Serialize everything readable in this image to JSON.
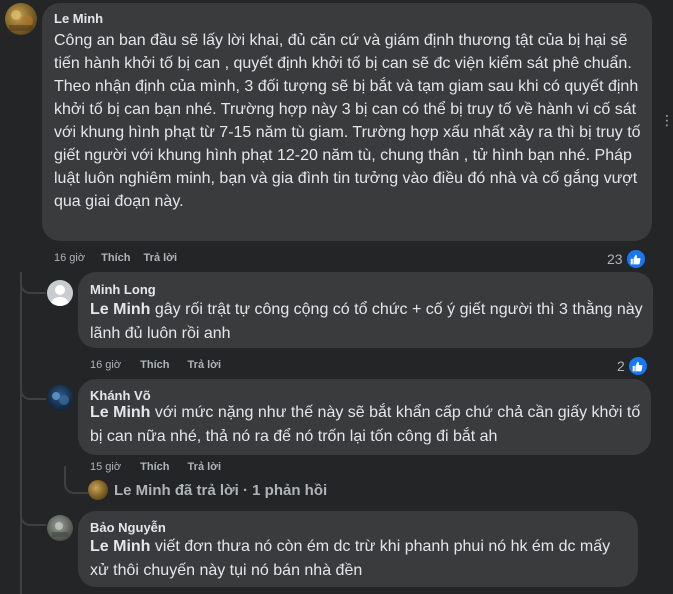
{
  "comments": [
    {
      "author": "Le Minh",
      "text": "Công an ban đầu sẽ lấy lời khai, đủ căn cứ và giám định thương tật của bị hại sẽ tiến hành khởi tố bị can , quyết định khởi tố bị can sẽ đc viện kiểm sát phê chuẩn. Theo nhận định của mình, 3 đối tượng sẽ bị bắt và tạm giam sau khi có quyết định khởi tố bị can bạn nhé. Trường hợp này 3 bị can có thể bị truy tố về hành vi cố sát với khung hình phạt từ 7-15 năm tù giam. Trường hợp xấu nhất xảy ra thì bị truy tố giết người với khung hình phạt 12-20 năm tù, chung thân , tử hình bạn nhé. Pháp luật luôn nghiêm minh, bạn và gia đình tin tưởng vào điều đó nhà và cố gắng vượt qua giai đoạn này.",
      "time": "16 giờ",
      "like_label": "Thích",
      "reply_label": "Trả lời",
      "reaction_count": "23"
    },
    {
      "author": "Minh Long",
      "mention": "Le Minh",
      "text": " gây rối trật tự công cộng có tổ chức + cố ý giết người thì 3 thằng này lãnh đủ luôn rồi anh",
      "time": "16 giờ",
      "like_label": "Thích",
      "reply_label": "Trả lời",
      "reaction_count": "2"
    },
    {
      "author": "Khánh Võ",
      "mention": "Le Minh",
      "text": " với mức nặng như thế này sẽ bắt khẩn cấp chứ chả cần giấy khởi tố bị can nữa nhé, thả nó ra để nó trốn lại tốn công đi bắt ah",
      "time": "15 giờ",
      "like_label": "Thích",
      "reply_label": "Trả lời"
    },
    {
      "author": "Bảo Nguyễn",
      "mention": "Le Minh",
      "text": " viết đơn thưa nó còn ém dc trừ khi phanh phui nó hk ém dc mấy xử thôi chuyến này tụi nó bán nhà đền"
    }
  ],
  "replied_summary": "Le Minh đã trả lời · 1 phản hồi",
  "colors": {
    "background": "#242526",
    "bubble": "#3a3b3c",
    "text": "#e4e6eb",
    "secondary_text": "#b0b3b8",
    "like_blue": "#1877f2"
  }
}
